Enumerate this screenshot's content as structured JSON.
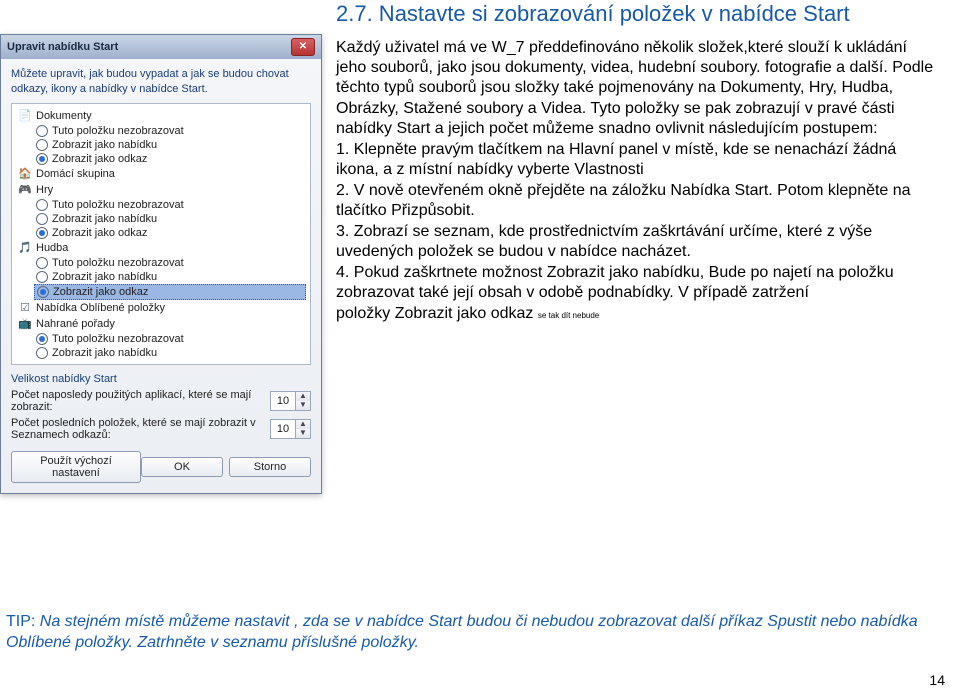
{
  "heading": "2.7. Nastavte si zobrazování položek v nabídce Start",
  "body_text": "Každý uživatel má ve W_7 předdefinováno několik složek,které slouží k ukládání jeho souborů, jako jsou dokumenty, videa, hudební soubory. fotografie a další. Podle těchto typů souborů jsou složky také pojmenovány na Dokumenty, Hry, Hudba, Obrázky, Stažené soubory a Videa. Tyto položky se pak zobrazují v pravé části nabídky Start a jejich počet můžeme snadno ovlivnit následujícím postupem:\n    1. Klepněte pravým tlačítkem na Hlavní panel v místě, kde se nenachází žádná ikona, a z místní nabídky vyberte Vlastnosti\n    2. V nově otevřeném okně přejděte na záložku Nabídka Start. Potom klepněte na tlačítko Přizpůsobit.\n    3. Zobrazí se seznam, kde prostřednictvím zaškrtávání určíme, které z výše uvedených položek se budou v nabídce nacházet.\n    4. Pokud zaškrtnete možnost Zobrazit jako nabídku, Bude po najetí na položku zobrazovat také její obsah v odobě podnabídky. V případě zatržení\npoložky Zobrazit jako odkaz ",
  "small_tail": "se tak dít nebude",
  "dialog": {
    "title": "Upravit nabídku Start",
    "close_label": "✕",
    "desc": "Můžete upravit, jak budou vypadat a jak se budou chovat odkazy, ikony a nabídky v nabídce Start.",
    "groups": [
      {
        "icon": "📄",
        "label": "Dokumenty",
        "options": [
          {
            "type": "radio",
            "checked": false,
            "label": "Tuto položku nezobrazovat"
          },
          {
            "type": "radio",
            "checked": false,
            "label": "Zobrazit jako nabídku"
          },
          {
            "type": "radio",
            "checked": true,
            "label": "Zobrazit jako odkaz"
          }
        ]
      },
      {
        "icon": "🏠",
        "label": "Domácí skupina",
        "options": []
      },
      {
        "icon": "🎮",
        "label": "Hry",
        "options": [
          {
            "type": "radio",
            "checked": false,
            "label": "Tuto položku nezobrazovat"
          },
          {
            "type": "radio",
            "checked": false,
            "label": "Zobrazit jako nabídku"
          },
          {
            "type": "radio",
            "checked": true,
            "label": "Zobrazit jako odkaz"
          }
        ]
      },
      {
        "icon": "🎵",
        "label": "Hudba",
        "options": [
          {
            "type": "radio",
            "checked": false,
            "label": "Tuto položku nezobrazovat"
          },
          {
            "type": "radio",
            "checked": false,
            "label": "Zobrazit jako nabídku"
          },
          {
            "type": "radio",
            "checked": true,
            "label": "Zobrazit jako odkaz",
            "selected": true
          }
        ]
      },
      {
        "icon": "☑",
        "label": "Nabídka Oblíbené položky",
        "options": []
      },
      {
        "icon": "📺",
        "label": "Nahrané pořady",
        "options": [
          {
            "type": "radio",
            "checked": true,
            "label": "Tuto položku nezobrazovat"
          },
          {
            "type": "radio",
            "checked": false,
            "label": "Zobrazit jako nabídku"
          }
        ]
      }
    ],
    "size_label": "Velikost nabídky Start",
    "count_rows": [
      {
        "label": "Počet naposledy použitých aplikací, které se mají zobrazit:",
        "value": "10"
      },
      {
        "label": "Počet posledních položek, které se mají zobrazit v Seznamech odkazů:",
        "value": "10"
      }
    ],
    "buttons": {
      "defaults": "Použít výchozí nastavení",
      "ok": "OK",
      "cancel": "Storno"
    }
  },
  "tip_prefix": "TIP: ",
  "tip_body": "Na stejném místě můžeme nastavit , zda se v nabídce Start budou či nebudou zobrazovat další příkaz Spustit nebo nabídka Oblíbené položky. Zatrhněte v seznamu příslušné položky.",
  "page_number": "14"
}
